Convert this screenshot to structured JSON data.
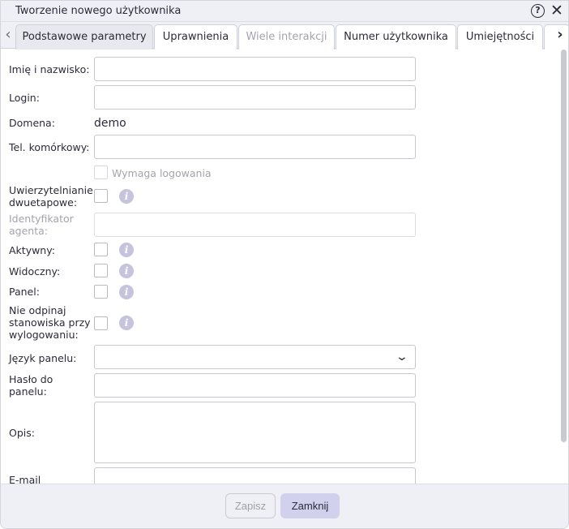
{
  "window": {
    "title": "Tworzenie nowego użytkownika",
    "help_symbol": "?",
    "close_symbol": "✕"
  },
  "tabs": [
    {
      "label": "Podstawowe parametry",
      "state": "active"
    },
    {
      "label": "Uprawnienia",
      "state": "normal"
    },
    {
      "label": "Wiele interakcji",
      "state": "disabled"
    },
    {
      "label": "Numer użytkownika",
      "state": "normal"
    },
    {
      "label": "Umiejętności",
      "state": "normal"
    },
    {
      "label": "",
      "state": "normal"
    }
  ],
  "tab_nav": {
    "prev": "‹",
    "next": "›"
  },
  "form": {
    "full_name_label": "Imię i nazwisko:",
    "full_name_value": "",
    "login_label": "Login:",
    "login_value": "",
    "domain_label": "Domena:",
    "domain_value": "demo",
    "mobile_label": "Tel. komórkowy:",
    "mobile_value": "",
    "requires_login_label": "Wymaga logowania",
    "two_factor_label_1": "Uwierzytelnianie",
    "two_factor_label_2": "dwuetapowe:",
    "agent_id_label_1": "Identyfikator",
    "agent_id_label_2": "agenta:",
    "agent_id_value": "",
    "active_label": "Aktywny:",
    "visible_label": "Widoczny:",
    "panel_label": "Panel:",
    "keep_station_label_1": "Nie odpinaj",
    "keep_station_label_2": "stanowiska przy",
    "keep_station_label_3": "wylogowaniu:",
    "panel_language_label": "Język panelu:",
    "panel_language_value": "",
    "panel_password_label_1": "Hasło do",
    "panel_password_label_2": "panelu:",
    "description_label": "Opis:",
    "email_label": "E-mail",
    "info_symbol": "i"
  },
  "footer": {
    "save_label": "Zapisz",
    "close_label": "Zamknij"
  },
  "colors": {
    "accent_button": "#d1d0ed",
    "info_badge": "#c5c4dc",
    "chrome_bg": "#eef0f5"
  },
  "icons": [
    "help-icon",
    "close-icon",
    "chevron-left-icon",
    "chevron-right-icon",
    "info-icon",
    "chevron-down-icon"
  ]
}
